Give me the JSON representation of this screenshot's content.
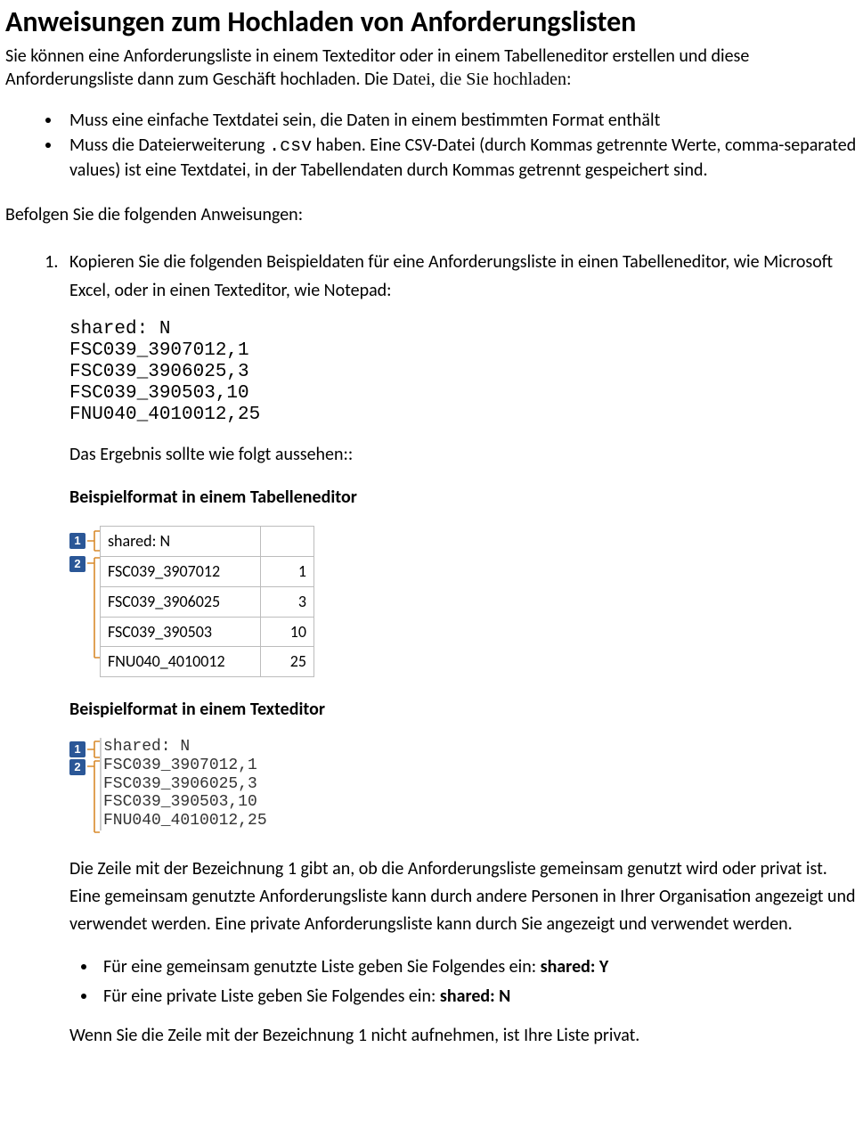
{
  "title": "Anweisungen zum Hochladen von Anforderungslisten",
  "intro_part1": "Sie können eine Anforderungsliste in einem Texteditor oder in einem Tabelleneditor erstellen und diese Anforderungsliste dann zum Geschäft hochladen. Die ",
  "intro_phrase": "Datei, die Sie hochladen:",
  "bullets_top": {
    "b1": "Muss eine einfache Textdatei sein, die  Daten in einem bestimmten Format enthält",
    "b2_part1": "Muss die Dateierweiterung ",
    "b2_code": ".csv",
    "b2_part2": " haben.  Eine CSV-Datei (durch Kommas getrennte Werte, comma-separated values) ist eine Textdatei, in der Tabellendaten durch Kommas getrennt gespeichert sind."
  },
  "follow": "Befolgen Sie die folgenden Anweisungen:",
  "step1_intro": "Kopieren Sie die folgenden Beispieldaten für eine Anforderungsliste in einen Tabelleneditor, wie Microsoft Excel, oder in einen Texteditor, wie Notepad:",
  "code_block": "shared: N\nFSC039_3907012,1\nFSC039_3906025,3\nFSC039_390503,10\nFNU040_4010012,25",
  "result_line": "Das Ergebnis sollte wie folgt aussehen::",
  "subhead_table": "Beispielformat in einem Tabelleneditor",
  "callout_1": "1",
  "callout_2": "2",
  "spreadsheet": {
    "r1a": "shared: N",
    "r1b": "",
    "r2a": "FSC039_3907012",
    "r2b": "1",
    "r3a": "FSC039_3906025",
    "r3b": "3",
    "r4a": "FSC039_390503",
    "r4b": "10",
    "r5a": "FNU040_4010012",
    "r5b": "25"
  },
  "subhead_text": "Beispielformat in einem Texteditor",
  "texteditor_block": "shared: N\nFSC039_3907012,1\nFSC039_3906025,3\nFSC039_390503,10\nFNU040_4010012,25",
  "explain_para": "Die Zeile mit der Bezeichnung 1 gibt an, ob die  Anforderungsliste gemeinsam genutzt wird oder privat ist. Eine gemeinsam genutzte Anforderungsliste kann durch andere Personen in Ihrer Organisation angezeigt und verwendet werden. Eine private Anforderungsliste kann durch Sie angezeigt und verwendet werden.",
  "inner_bullets": {
    "b1_text": "Für eine gemeinsam genutzte Liste geben Sie Folgendes ein: ",
    "b1_bold": "shared: Y",
    "b2_text": "Für eine private Liste geben Sie Folgendes ein: ",
    "b2_bold": "shared: N"
  },
  "last_para": "Wenn Sie die Zeile mit der Bezeichnung 1 nicht aufnehmen, ist Ihre Liste privat."
}
